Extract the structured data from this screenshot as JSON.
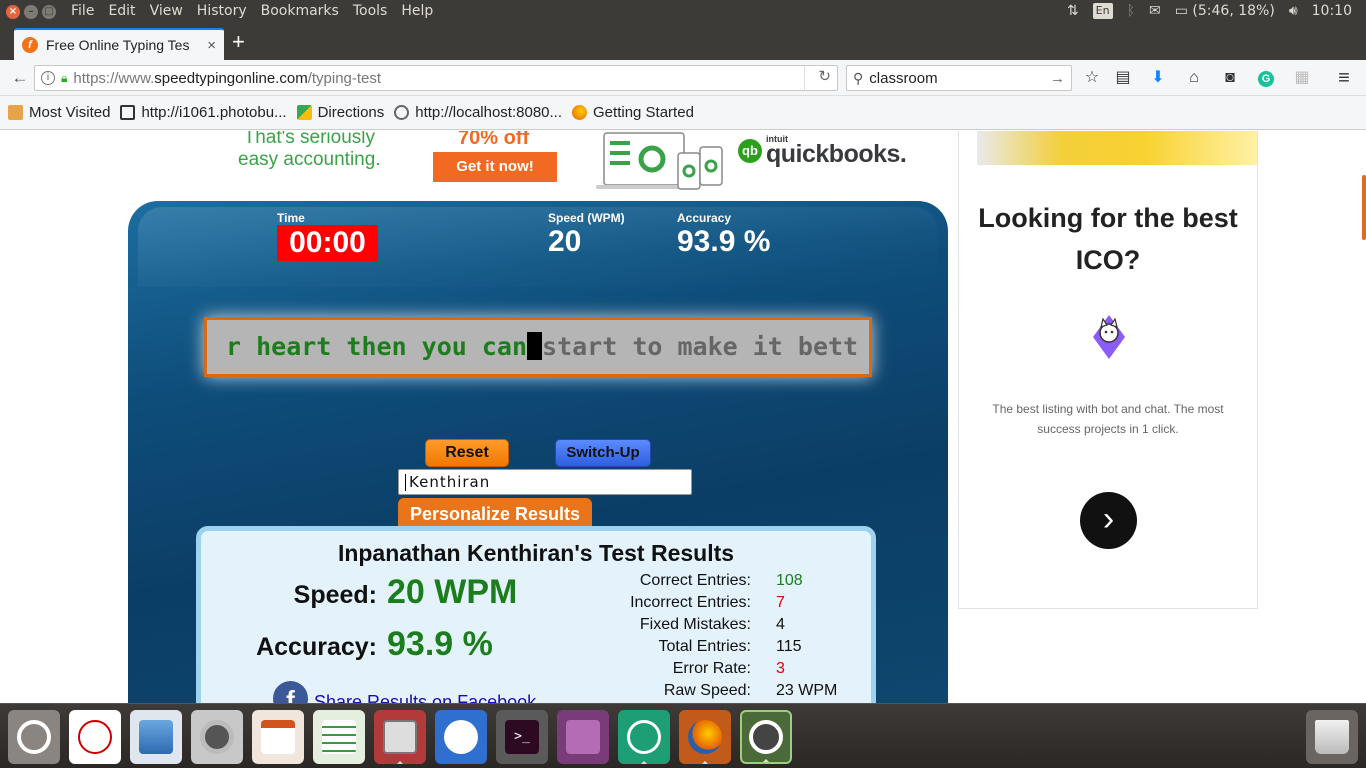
{
  "system": {
    "menus": [
      "File",
      "Edit",
      "View",
      "History",
      "Bookmarks",
      "Tools",
      "Help"
    ],
    "keyboard_layout": "En",
    "battery": "(5:46, 18%)",
    "clock": "10:10"
  },
  "browser": {
    "tab_title": "Free Online Typing Tes",
    "url_scheme": "https://www.",
    "url_host": "speedtypingonline.com",
    "url_path": "/typing-test",
    "search_value": "classroom",
    "bookmarks": [
      "Most Visited",
      "http://i1061.photobu...",
      "Directions",
      "http://localhost:8080...",
      "Getting Started"
    ]
  },
  "ad_banner": {
    "line1": "That's seriously",
    "line2": "easy accounting.",
    "discount": "70% off",
    "cta": "Get it now!",
    "brand_prefix": "intuit",
    "brand": "quickbooks."
  },
  "test": {
    "time_label": "Time",
    "time_value": "00:00",
    "speed_label": "Speed (WPM)",
    "speed_value": "20",
    "accuracy_label": "Accuracy",
    "accuracy_value": "93.9 %",
    "typed_text": "r heart then you can",
    "untyped_text": "start to make it bett",
    "reset_label": "Reset",
    "switch_label": "Switch-Up",
    "name_value": "Kenthiran",
    "personalize_label": "Personalize Results"
  },
  "results": {
    "title": "Inpanathan Kenthiran's Test Results",
    "speed_label": "Speed:",
    "speed_value": "20 WPM",
    "accuracy_label": "Accuracy:",
    "accuracy_value": "93.9 %",
    "details": [
      {
        "label": "Correct Entries:",
        "value": "108",
        "color": "green"
      },
      {
        "label": "Incorrect Entries:",
        "value": "7",
        "color": "red"
      },
      {
        "label": "Fixed Mistakes:",
        "value": "4",
        "color": "black"
      },
      {
        "label": "Total Entries:",
        "value": "115",
        "color": "black"
      },
      {
        "label": "Error Rate:",
        "value": "3",
        "color": "red"
      },
      {
        "label": "Raw Speed:",
        "value": "23 WPM",
        "color": "black"
      }
    ],
    "share_label": "Share Results on Facebook"
  },
  "right_ad": {
    "title": "Looking for the best ICO?",
    "description": "The best listing with bot and chat. The most success projects in 1 click."
  },
  "launcher": {
    "apps": [
      "ubuntu-dash",
      "evince",
      "image-viewer",
      "shotwell",
      "impress",
      "calc",
      "file-manager",
      "browser-safari-like",
      "terminal",
      "workspace-switcher",
      "atom",
      "firefox",
      "software-updater"
    ]
  },
  "colors": {
    "accent_orange": "#e8741c",
    "panel_blue": "#0e4d7a",
    "timer_red": "#ff0000",
    "typed_green": "#1b7d1b"
  }
}
